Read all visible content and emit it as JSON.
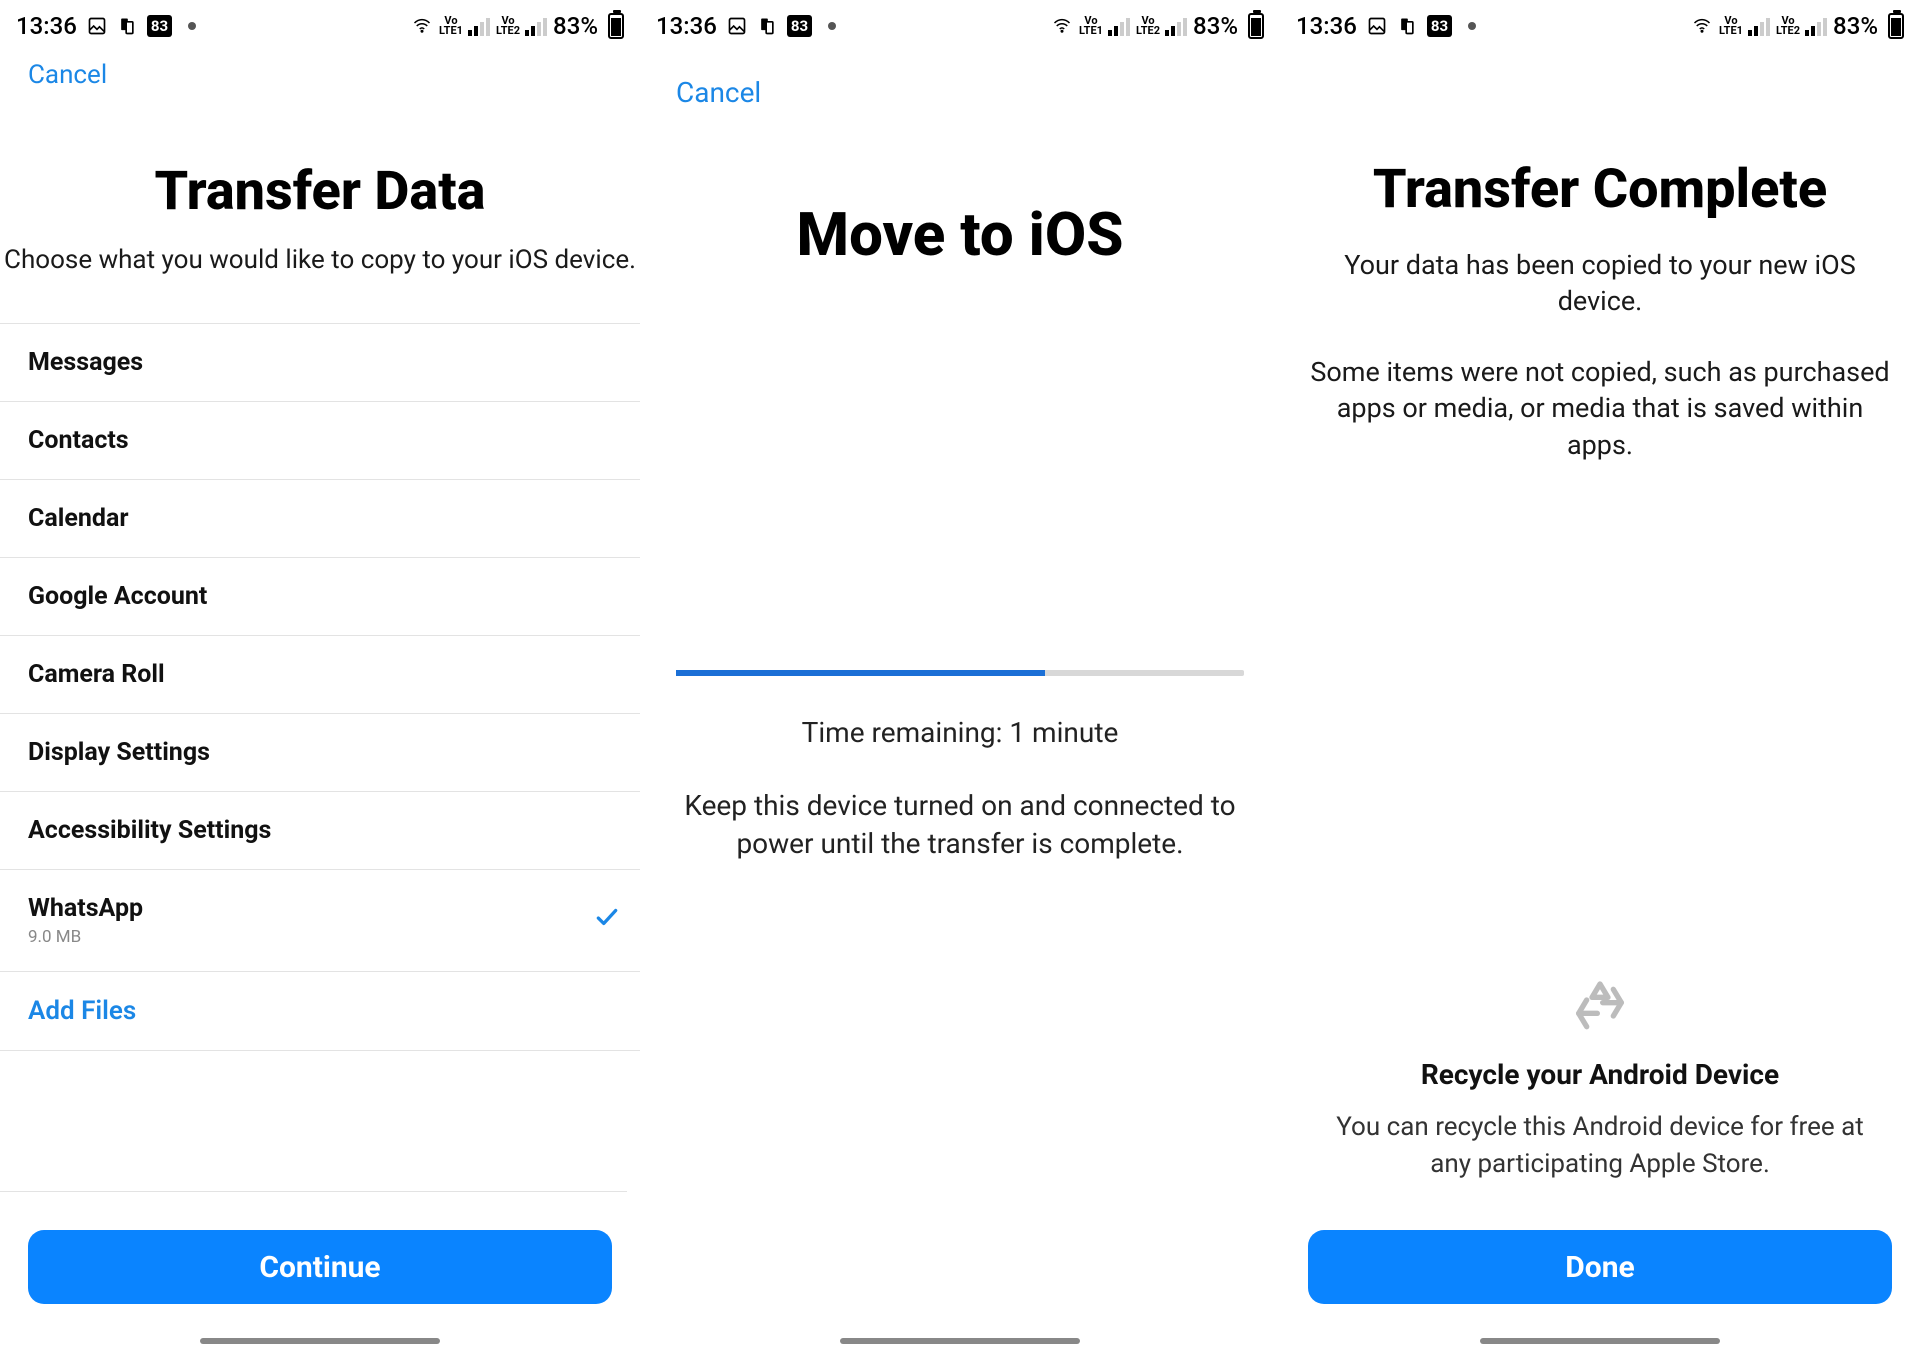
{
  "status": {
    "time": "13:36",
    "battery_pct": "83%",
    "badge": "83",
    "lte1": "Vo LTE1",
    "lte2": "Vo LTE2"
  },
  "screen1": {
    "cancel": "Cancel",
    "title": "Transfer Data",
    "subtitle": "Choose what you would like to copy to your iOS device.",
    "items": [
      {
        "label": "Messages",
        "subtitle": "",
        "checked": false
      },
      {
        "label": "Contacts",
        "subtitle": "",
        "checked": false
      },
      {
        "label": "Calendar",
        "subtitle": "",
        "checked": false
      },
      {
        "label": "Google Account",
        "subtitle": "",
        "checked": false
      },
      {
        "label": "Camera Roll",
        "subtitle": "",
        "checked": false
      },
      {
        "label": "Display Settings",
        "subtitle": "",
        "checked": false
      },
      {
        "label": "Accessibility Settings",
        "subtitle": "",
        "checked": false
      },
      {
        "label": "WhatsApp",
        "subtitle": "9.0 MB",
        "checked": true
      }
    ],
    "add_files": "Add Files",
    "continue": "Continue"
  },
  "screen2": {
    "cancel": "Cancel",
    "title": "Move to iOS",
    "progress_pct": 65,
    "time_remaining": "Time remaining: 1 minute",
    "note": "Keep this device turned on and connected to power until the transfer is complete."
  },
  "screen3": {
    "title": "Transfer Complete",
    "msg1": "Your data has been copied to your new iOS device.",
    "msg2": "Some items were not copied, such as purchased apps or media, or media that is saved within apps.",
    "recycle_title": "Recycle your Android Device",
    "recycle_text": "You can recycle this Android device for free at any participating Apple Store.",
    "done": "Done"
  }
}
